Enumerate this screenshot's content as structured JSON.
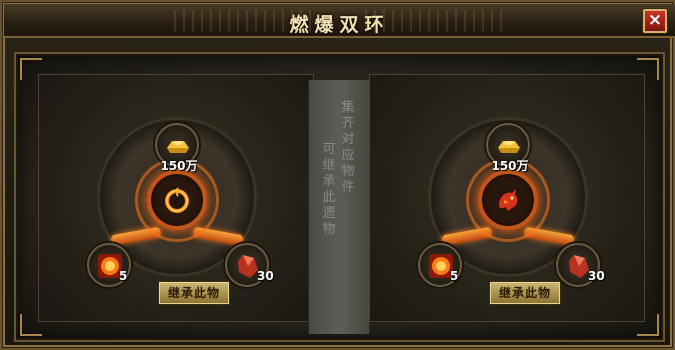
{
  "window": {
    "title": "燃爆双环",
    "close_label": "×"
  },
  "divider": {
    "line1": "集齐对应物件",
    "line2": "可继承此遗物"
  },
  "panels": [
    {
      "core_icon": "fire-ring-icon",
      "slots": [
        {
          "icon": "gold-ingot-icon",
          "count": "150万"
        },
        {
          "icon": "fire-orb-icon",
          "count": "5"
        },
        {
          "icon": "red-crystal-icon",
          "count": "30"
        }
      ],
      "button_label": "继承此物"
    },
    {
      "core_icon": "fire-dragon-icon",
      "slots": [
        {
          "icon": "gold-ingot-icon",
          "count": "150万"
        },
        {
          "icon": "fire-orb-icon",
          "count": "5"
        },
        {
          "icon": "red-crystal-icon",
          "count": "30"
        }
      ],
      "button_label": "继承此物"
    }
  ],
  "colors": {
    "accent": "#ff7a1a",
    "gold": "#e8d493",
    "close": "#c8342a"
  }
}
